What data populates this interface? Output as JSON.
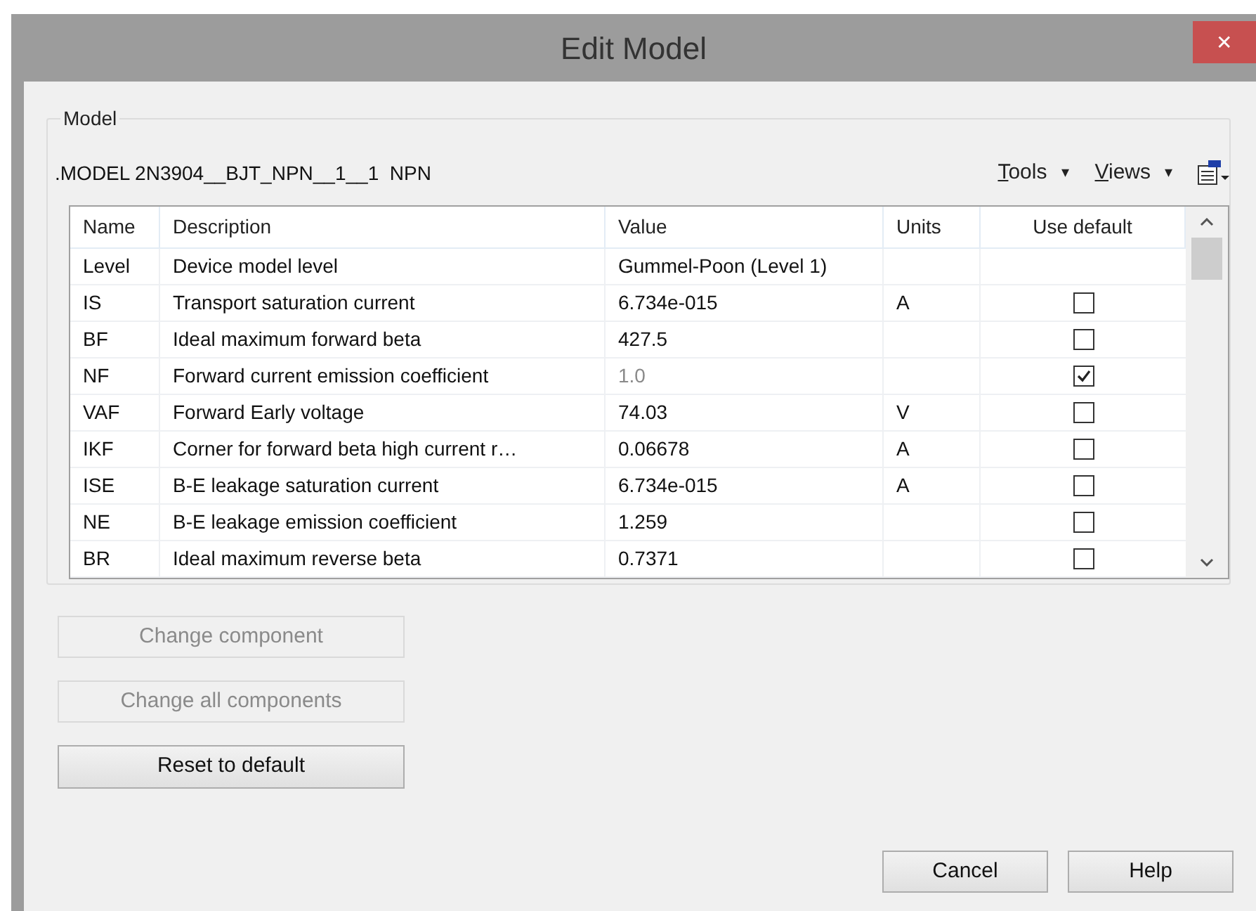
{
  "window": {
    "title": "Edit Model",
    "close": "✕"
  },
  "group": {
    "label": "Model"
  },
  "model_line": ".MODEL 2N3904__BJT_NPN__1__1  NPN",
  "menus": [
    {
      "label": "Tools",
      "caret": "▾"
    },
    {
      "label": "Views",
      "caret": "▾"
    }
  ],
  "table": {
    "columns": [
      "Name",
      "Description",
      "Value",
      "Units",
      "Use default"
    ],
    "rows": [
      {
        "kind": "plain",
        "name": "Level",
        "description": "Device model level",
        "value": "Gummel-Poon (Level 1)",
        "units": ""
      },
      {
        "kind": "checkbox",
        "name": "IS",
        "description": "Transport saturation current",
        "value": "6.734e-015",
        "units": "A",
        "use_default": false
      },
      {
        "kind": "checkbox",
        "name": "BF",
        "description": "Ideal maximum forward beta",
        "value": "427.5",
        "units": "",
        "use_default": false
      },
      {
        "kind": "checkbox",
        "name": "NF",
        "description": "Forward current emission coefficient",
        "value": "1.0",
        "units": "",
        "use_default": true
      },
      {
        "kind": "checkbox",
        "name": "VAF",
        "description": "Forward Early voltage",
        "value": "74.03",
        "units": "V",
        "use_default": false
      },
      {
        "kind": "checkbox",
        "name": "IKF",
        "description": "Corner for forward beta high current r…",
        "value": "0.06678",
        "units": "A",
        "use_default": false
      },
      {
        "kind": "checkbox",
        "name": "ISE",
        "description": "B-E leakage saturation current",
        "value": "6.734e-015",
        "units": "A",
        "use_default": false
      },
      {
        "kind": "checkbox",
        "name": "NE",
        "description": "B-E leakage emission coefficient",
        "value": "1.259",
        "units": "",
        "use_default": false
      },
      {
        "kind": "checkbox",
        "name": "BR",
        "description": "Ideal maximum reverse beta",
        "value": "0.7371",
        "units": "",
        "use_default": false
      }
    ]
  },
  "side_buttons": [
    {
      "label": "Change component",
      "disabled": true
    },
    {
      "label": "Change all components",
      "disabled": true
    },
    {
      "label": "Reset to default",
      "disabled": false
    }
  ],
  "footer_buttons": [
    {
      "label": "Cancel"
    },
    {
      "label": "Help"
    }
  ]
}
